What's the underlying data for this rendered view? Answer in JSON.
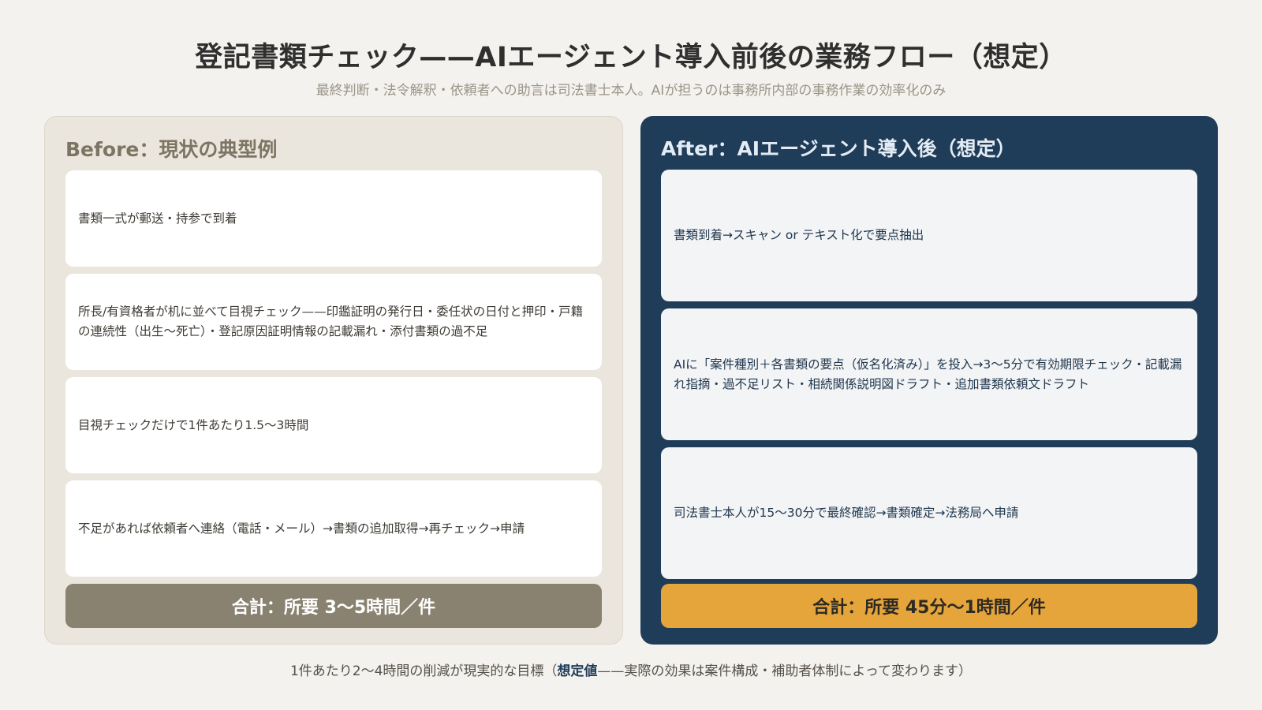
{
  "header": {
    "title": "登記書類チェック——AIエージェント導入前後の業務フロー（想定）",
    "subtitle": "最終判断・法令解釈・依頼者への助言は司法書士本人。AIが担うのは事務所内部の事務作業の効率化のみ"
  },
  "before": {
    "heading": "Before：現状の典型例",
    "steps": [
      "書類一式が郵送・持参で到着",
      "所長/有資格者が机に並べて目視チェック——印鑑証明の発行日・委任状の日付と押印・戸籍の連続性（出生〜死亡）・登記原因証明情報の記載漏れ・添付書類の過不足",
      "目視チェックだけで1件あたり1.5〜3時間",
      "不足があれば依頼者へ連絡（電話・メール）→書類の追加取得→再チェック→申請"
    ],
    "total": "合計：所要 3〜5時間／件"
  },
  "after": {
    "heading": "After：AIエージェント導入後（想定）",
    "steps": [
      "書類到着→スキャン or テキスト化で要点抽出",
      "AIに「案件種別＋各書類の要点（仮名化済み）」を投入→3〜5分で有効期限チェック・記載漏れ指摘・過不足リスト・相続関係説明図ドラフト・追加書類依頼文ドラフト",
      "司法書士本人が15〜30分で最終確認→書類確定→法務局へ申請"
    ],
    "total": "合計：所要 45分〜1時間／件"
  },
  "footnote": {
    "prefix": "1件あたり2〜4時間の削減が現実的な目標（",
    "emphasis": "想定値",
    "suffix": "——実際の効果は案件構成・補助者体制によって変わります）"
  },
  "colors": {
    "before_panel": "#ebe6dd",
    "before_total": "#8a8271",
    "after_panel": "#1f3c58",
    "after_total": "#e6a53a"
  }
}
